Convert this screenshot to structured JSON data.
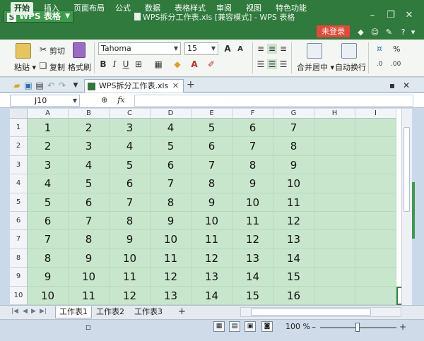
{
  "title_bar": {
    "app_button_label": "WPS 表格",
    "app_logo_letter": "S",
    "window_title": "WPS拆分工作表.xls [兼容模式] - WPS 表格"
  },
  "menu": {
    "items": [
      "开始",
      "插入",
      "页面布局",
      "公式",
      "数据",
      "表格样式",
      "审阅",
      "视图",
      "特色功能"
    ],
    "active_index": 0,
    "login_label": "未登录"
  },
  "ribbon": {
    "paste_label": "粘贴",
    "cut_label": "剪切",
    "copy_label": "复制",
    "format_painter_label": "格式刷",
    "font_name": "Tahoma",
    "font_size": "15",
    "merge_center_label": "合并居中",
    "wrap_text_label": "自动换行",
    "percent_label": "%"
  },
  "document_tab": {
    "file_name": "WPS拆分工作表.xls"
  },
  "formula_bar": {
    "name_box": "J10",
    "fx_label": "fx"
  },
  "grid": {
    "columns": [
      "A",
      "B",
      "C",
      "D",
      "E",
      "F",
      "G",
      "H",
      "I"
    ],
    "rows": [
      {
        "label": "1",
        "cells": [
          "1",
          "2",
          "3",
          "4",
          "5",
          "6",
          "7"
        ]
      },
      {
        "label": "2",
        "cells": [
          "2",
          "3",
          "4",
          "5",
          "6",
          "7",
          "8"
        ]
      },
      {
        "label": "3",
        "cells": [
          "3",
          "4",
          "5",
          "6",
          "7",
          "8",
          "9"
        ]
      },
      {
        "label": "4",
        "cells": [
          "4",
          "5",
          "6",
          "7",
          "8",
          "9",
          "10"
        ]
      },
      {
        "label": "5",
        "cells": [
          "5",
          "6",
          "7",
          "8",
          "9",
          "10",
          "11"
        ]
      },
      {
        "label": "6",
        "cells": [
          "6",
          "7",
          "8",
          "9",
          "10",
          "11",
          "12"
        ]
      },
      {
        "label": "7",
        "cells": [
          "7",
          "8",
          "9",
          "10",
          "11",
          "12",
          "13"
        ]
      },
      {
        "label": "8",
        "cells": [
          "8",
          "9",
          "10",
          "11",
          "12",
          "13",
          "14"
        ]
      },
      {
        "label": "9",
        "cells": [
          "9",
          "10",
          "11",
          "12",
          "13",
          "14",
          "15"
        ]
      },
      {
        "label": "10",
        "cells": [
          "10",
          "11",
          "12",
          "13",
          "14",
          "15",
          "16"
        ]
      }
    ],
    "cell_fill_color": "#c8e6cc",
    "active_cell": "J10"
  },
  "sheets": {
    "tabs": [
      "工作表1",
      "工作表2",
      "工作表3"
    ],
    "active_index": 0,
    "add_label": "+"
  },
  "status_bar": {
    "zoom_label": "100 %"
  },
  "colors": {
    "title_green": "#2f7a3c",
    "login_red": "#e2493a",
    "cell_green": "#c8e6cc"
  }
}
